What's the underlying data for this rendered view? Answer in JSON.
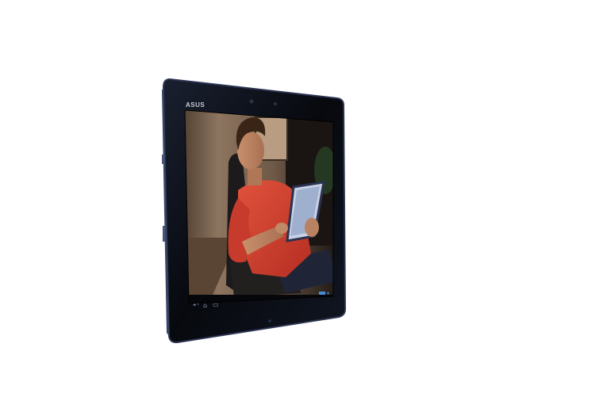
{
  "device": {
    "brand": "ASUS",
    "status_icons": [
      "back-icon",
      "home-icon",
      "recent-apps-icon",
      "wifi-icon"
    ]
  },
  "screen": {
    "content": "video-frame"
  },
  "colors": {
    "bezel": "#0c0f17",
    "bezel_edge": "#2a3350",
    "screen_wall": "#8a7058",
    "shirt": "#d8412f",
    "background": "#ffffff"
  }
}
